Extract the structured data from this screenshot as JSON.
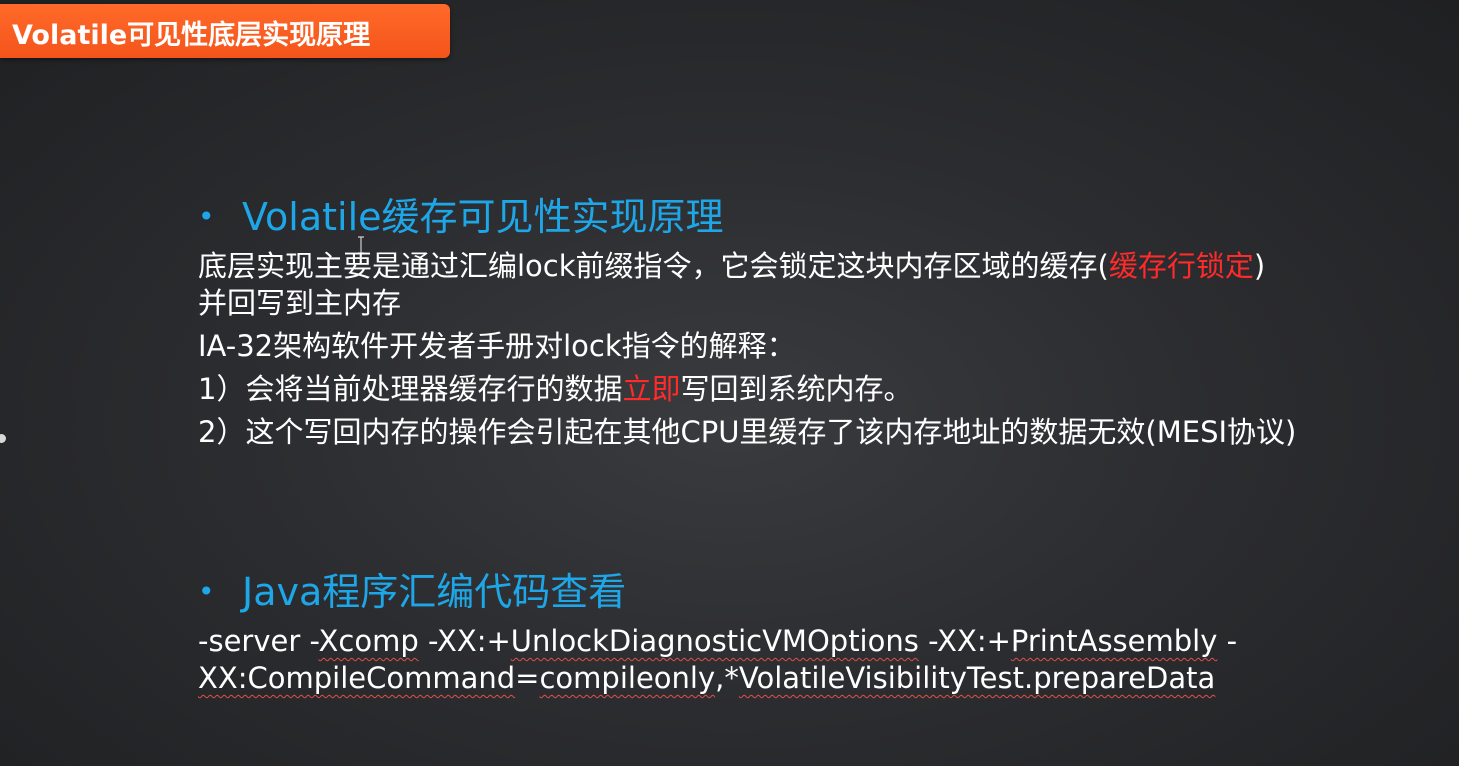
{
  "slide": {
    "title": "Volatile可见性底层实现原理"
  },
  "section1": {
    "bullet": "•",
    "heading": "Volatile缓存可见性实现原理",
    "line1_a": "底层实现主要是通过汇编lock前缀指令，它会锁定这块内存区域的缓存(",
    "line1_highlight": "缓存行锁定",
    "line1_b": ")",
    "line2": "并回写到主内存",
    "line3": "IA-32架构软件开发者手册对lock指令的解释：",
    "line4_a": "1）会将当前处理器缓存行的数据",
    "line4_highlight": "立即",
    "line4_b": "写回到系统内存。",
    "line5": "2）这个写回内存的操作会引起在其他CPU里缓存了该内存地址的数据无效(MESI协议)"
  },
  "section2": {
    "bullet": "•",
    "heading": "Java程序汇编代码查看",
    "code_line1": {
      "t1": "-server -",
      "w1": "Xcomp",
      "t2": " -XX:+",
      "w2": "UnlockDiagnosticVMOptions",
      "t3": " -XX:+",
      "w3": "PrintAssembly",
      "t4": " -"
    },
    "code_line2": {
      "w1": "XX:CompileCommand",
      "t1": "=",
      "w2": "compileonly",
      "t2": ",*",
      "w3": "VolatileVisibilityTest.prepareData"
    }
  },
  "colors": {
    "banner": "#f4541a",
    "heading": "#1ea7e8",
    "highlight": "#ff2a2a",
    "text": "#ffffff",
    "background": "#2c2d30"
  }
}
